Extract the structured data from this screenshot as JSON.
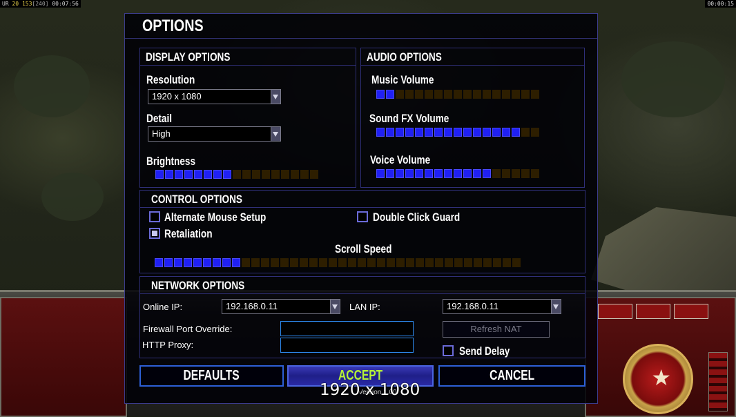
{
  "hud": {
    "top_left_stat": {
      "a": "UR",
      "b": "20",
      "c": "153",
      "d": "[240]",
      "e": "00:07:56"
    },
    "top_right_clock": "00:00:15"
  },
  "dialog": {
    "title": "OPTIONS",
    "display": {
      "heading": "DISPLAY OPTIONS",
      "resolution_label": "Resolution",
      "resolution_value": "1920 x 1080",
      "detail_label": "Detail",
      "detail_value": "High",
      "brightness_label": "Brightness",
      "brightness_level": 8,
      "brightness_max": 17
    },
    "audio": {
      "heading": "AUDIO OPTIONS",
      "music_label": "Music Volume",
      "music_level": 2,
      "sfx_label": "Sound FX Volume",
      "sfx_level": 15,
      "voice_label": "Voice Volume",
      "voice_level": 12,
      "audio_max": 17
    },
    "control": {
      "heading": "CONTROL OPTIONS",
      "alt_mouse_label": "Alternate Mouse Setup",
      "alt_mouse_checked": false,
      "double_click_label": "Double Click Guard",
      "double_click_checked": false,
      "retaliation_label": "Retaliation",
      "retaliation_checked": true,
      "scroll_label": "Scroll Speed",
      "scroll_level": 9,
      "scroll_max": 38
    },
    "network": {
      "heading": "NETWORK OPTIONS",
      "online_ip_label": "Online IP:",
      "online_ip_value": "192.168.0.11",
      "lan_ip_label": "LAN IP:",
      "lan_ip_value": "192.168.0.11",
      "firewall_label": "Firewall Port Override:",
      "firewall_value": "",
      "proxy_label": "HTTP Proxy:",
      "proxy_value": "",
      "refresh_label": "Refresh NAT",
      "send_delay_label": "Send Delay",
      "send_delay_checked": false
    },
    "buttons": {
      "defaults": "DEFAULTS",
      "accept": "ACCEPT",
      "cancel": "CANCEL"
    },
    "version": "Version 1.00"
  },
  "overlay_resolution": "1920 x 1080",
  "colors": {
    "slider_on": "#2020f4",
    "slider_off": "#2d1e00",
    "accent_border": "#2d5fd6",
    "accept_text": "#b5f238"
  }
}
